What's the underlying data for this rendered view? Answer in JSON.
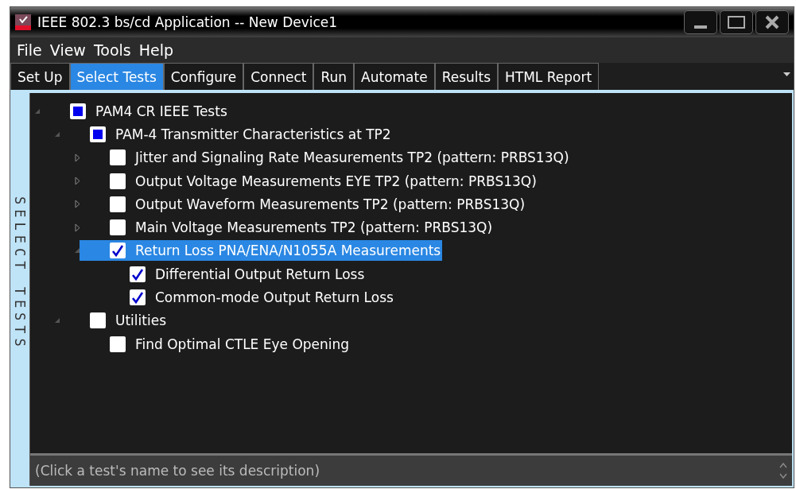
{
  "window": {
    "title": "IEEE 802.3 bs/cd Application -- New Device1"
  },
  "menu": [
    "File",
    "View",
    "Tools",
    "Help"
  ],
  "tabs": [
    {
      "label": "Set Up",
      "selected": false
    },
    {
      "label": "Select Tests",
      "selected": true
    },
    {
      "label": "Configure",
      "selected": false
    },
    {
      "label": "Connect",
      "selected": false
    },
    {
      "label": "Run",
      "selected": false
    },
    {
      "label": "Automate",
      "selected": false
    },
    {
      "label": "Results",
      "selected": false
    },
    {
      "label": "HTML Report",
      "selected": false
    }
  ],
  "side_label": "SELECT TESTS",
  "tree": [
    {
      "label": "PAM4 CR IEEE Tests",
      "partial": true,
      "expanded": true,
      "selected": false,
      "children": [
        {
          "label": "PAM-4 Transmitter Characteristics at TP2",
          "partial": true,
          "expanded": true,
          "selected": false,
          "children": [
            {
              "label": "Jitter and Signaling Rate Measurements TP2 (pattern: PRBS13Q)",
              "checked": false,
              "expanded": false,
              "selected": false
            },
            {
              "label": "Output Voltage Measurements EYE TP2 (pattern: PRBS13Q)",
              "checked": false,
              "expanded": false,
              "selected": false
            },
            {
              "label": "Output Waveform Measurements TP2 (pattern: PRBS13Q)",
              "checked": false,
              "expanded": false,
              "selected": false
            },
            {
              "label": "Main Voltage Measurements TP2 (pattern: PRBS13Q)",
              "checked": false,
              "expanded": false,
              "selected": false
            },
            {
              "label": "Return Loss PNA/ENA/N1055A Measurements",
              "checked": true,
              "expanded": true,
              "selected": true,
              "children": [
                {
                  "label": "Differential Output Return Loss",
                  "checked": true,
                  "selected": false
                },
                {
                  "label": "Common-mode Output Return Loss",
                  "checked": true,
                  "selected": false
                }
              ]
            }
          ]
        },
        {
          "label": "Utilities",
          "checked": false,
          "expanded": true,
          "selected": false,
          "children": [
            {
              "label": "Find Optimal CTLE Eye Opening",
              "checked": false,
              "selected": false
            }
          ]
        }
      ]
    }
  ],
  "description": "(Click a test's name to see its description)"
}
